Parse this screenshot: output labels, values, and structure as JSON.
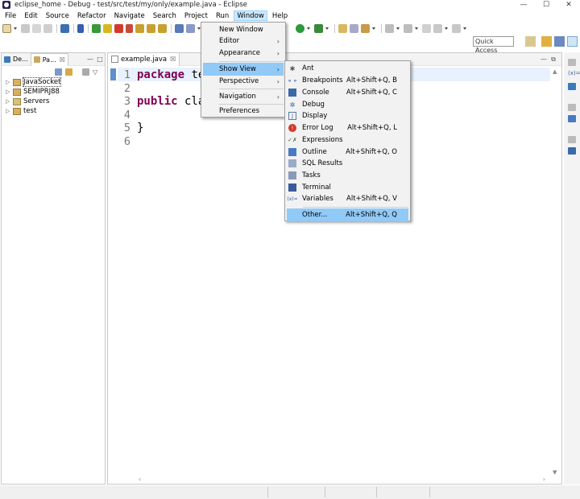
{
  "window": {
    "title": "eclipse_home - Debug - test/src/test/my/only/example.java - Eclipse",
    "minimize": "—",
    "maximize": "☐",
    "close": "✕"
  },
  "menubar": [
    "File",
    "Edit",
    "Source",
    "Refactor",
    "Navigate",
    "Search",
    "Project",
    "Run",
    "Window",
    "Help"
  ],
  "toolbar": {
    "quick_access": "Quick Access"
  },
  "left_panel": {
    "tabs": [
      {
        "label": "De...",
        "active": false
      },
      {
        "label": "Pa...",
        "active": true
      }
    ],
    "tree": [
      {
        "label": "JavaSocket",
        "selected": true
      },
      {
        "label": "SEMIPRJ88",
        "selected": false
      },
      {
        "label": "Servers",
        "selected": false
      },
      {
        "label": "test",
        "selected": false
      }
    ],
    "close_glyph": "☒",
    "minimize_glyph": "—",
    "maximize_glyph": "□"
  },
  "editor": {
    "tab_label": "example.java",
    "line_numbers": [
      "1",
      "2",
      "3",
      "4",
      "5",
      "6"
    ],
    "code": [
      {
        "kw": "package",
        "rest": " te"
      },
      {
        "kw": "",
        "rest": ""
      },
      {
        "kw": "public",
        "rest": " clas"
      },
      {
        "kw": "",
        "rest": ""
      },
      {
        "kw": "",
        "rest": "}"
      },
      {
        "kw": "",
        "rest": ""
      }
    ]
  },
  "window_menu": {
    "items": [
      {
        "label": "New Window",
        "submenu": false
      },
      {
        "label": "Editor",
        "submenu": true
      },
      {
        "label": "Appearance",
        "submenu": true
      },
      {
        "label": "Show View",
        "submenu": true,
        "highlighted": true
      },
      {
        "label": "Perspective",
        "submenu": true
      },
      {
        "label": "Navigation",
        "submenu": true
      },
      {
        "label": "Preferences",
        "submenu": false
      }
    ],
    "submenu_glyph": "›"
  },
  "show_view_menu": {
    "items": [
      {
        "label": "Ant",
        "accel": "",
        "icon": "ant-icon"
      },
      {
        "label": "Breakpoints",
        "accel": "Alt+Shift+Q, B",
        "icon": "breakpoints-icon"
      },
      {
        "label": "Console",
        "accel": "Alt+Shift+Q, C",
        "icon": "console-icon"
      },
      {
        "label": "Debug",
        "accel": "",
        "icon": "debug-icon"
      },
      {
        "label": "Display",
        "accel": "",
        "icon": "display-icon"
      },
      {
        "label": "Error Log",
        "accel": "Alt+Shift+Q, L",
        "icon": "error-log-icon"
      },
      {
        "label": "Expressions",
        "accel": "",
        "icon": "expressions-icon"
      },
      {
        "label": "Outline",
        "accel": "Alt+Shift+Q, O",
        "icon": "outline-icon"
      },
      {
        "label": "SQL Results",
        "accel": "",
        "icon": "sql-results-icon"
      },
      {
        "label": "Tasks",
        "accel": "",
        "icon": "tasks-icon"
      },
      {
        "label": "Terminal",
        "accel": "",
        "icon": "terminal-icon"
      },
      {
        "label": "Variables",
        "accel": "Alt+Shift+Q, V",
        "icon": "variables-icon"
      },
      {
        "label": "Other...",
        "accel": "Alt+Shift+Q, Q",
        "icon": "",
        "highlighted": true
      }
    ]
  },
  "colors": {
    "keyword": "#7f0055",
    "menu_highlight": "#91c9f7",
    "active_menu": "#cce8ff"
  }
}
